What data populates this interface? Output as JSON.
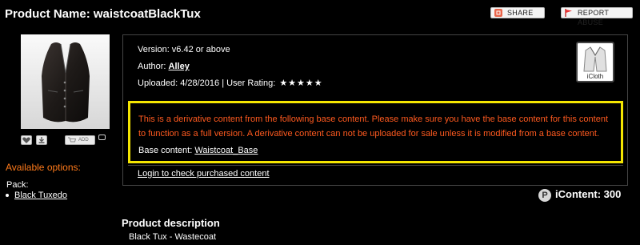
{
  "header": {
    "product_label": "Product Name:",
    "product_name": "waistcoatBlackTux",
    "share_label": "SHARE",
    "report_label": "REPORT ABUSE"
  },
  "thumbnail_buttons": {
    "cart_label": "ADD"
  },
  "available_options": {
    "label": "Available options:",
    "pack_label": "Pack:",
    "pack_items": [
      "Black Tuxedo"
    ]
  },
  "info": {
    "version": "Version: v6.42 or above",
    "author_label": "Author:",
    "author_name": "Alley",
    "uploaded": "Uploaded: 4/28/2016 | User Rating:",
    "rating_stars": 5
  },
  "iCloth_label": "iCloth",
  "derivative_notice": {
    "text": "This is a derivative content from the following base content. Please make sure you have the base content for this content to function as a full version. A derivative content can not be uploaded for sale unless it is modified from a base content.",
    "base_label": "Base content:",
    "base_link": "Waistcoat_Base"
  },
  "login_link": "Login to check purchased content",
  "price": {
    "badge": "P",
    "label": "iContent: 300"
  },
  "description": {
    "title": "Product description",
    "text": "Black Tux - Wastecoat"
  },
  "colors": {
    "accent_orange": "#ff5a1f",
    "highlight_yellow": "#f4e501"
  }
}
